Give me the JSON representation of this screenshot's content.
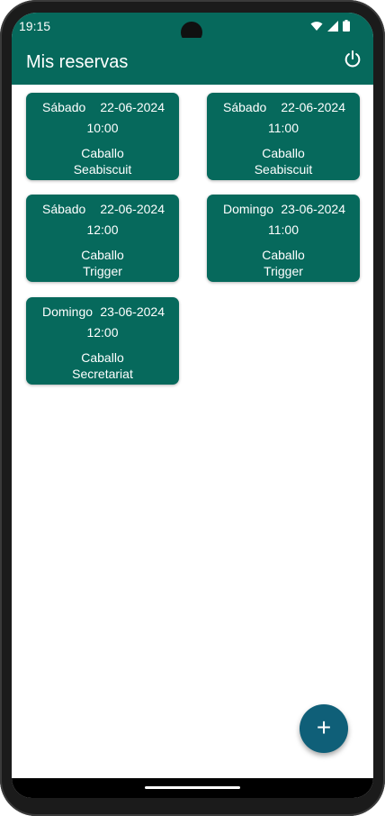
{
  "status_bar": {
    "time": "19:15"
  },
  "app_bar": {
    "title": "Mis reservas",
    "power_icon": "power-icon"
  },
  "colors": {
    "primary": "#06695c",
    "fab": "#0f5f78"
  },
  "reservations": [
    {
      "day": "Sábado",
      "date": "22-06-2024",
      "time": "10:00",
      "label": "Caballo",
      "horse": "Seabiscuit"
    },
    {
      "day": "Sábado",
      "date": "22-06-2024",
      "time": "11:00",
      "label": "Caballo",
      "horse": "Seabiscuit"
    },
    {
      "day": "Sábado",
      "date": "22-06-2024",
      "time": "12:00",
      "label": "Caballo",
      "horse": "Trigger"
    },
    {
      "day": "Domingo",
      "date": "23-06-2024",
      "time": "11:00",
      "label": "Caballo",
      "horse": "Trigger"
    },
    {
      "day": "Domingo",
      "date": "23-06-2024",
      "time": "12:00",
      "label": "Caballo",
      "horse": "Secretariat"
    }
  ],
  "fab": {
    "label": "+",
    "icon": "plus-icon"
  }
}
